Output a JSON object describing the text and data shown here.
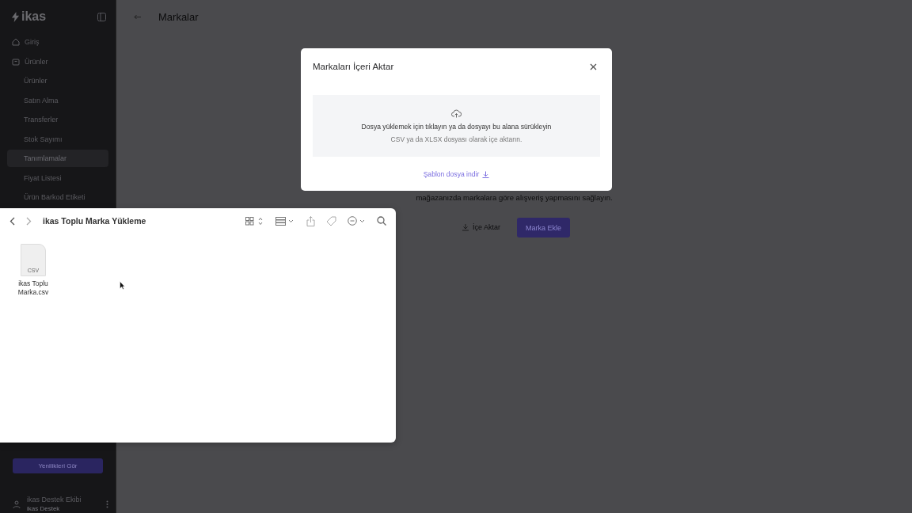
{
  "sidebar": {
    "logo": "ikas",
    "items": [
      {
        "label": "Giriş",
        "selected": false
      },
      {
        "label": "Ürünler",
        "selected": false,
        "children": [
          {
            "label": "Ürünler",
            "selected": false
          },
          {
            "label": "Satın Alma",
            "selected": false
          },
          {
            "label": "Transferler",
            "selected": false
          },
          {
            "label": "Stok Sayımı",
            "selected": false
          },
          {
            "label": "Tanımlamalar",
            "selected": true
          },
          {
            "label": "Fiyat Listesi",
            "selected": false
          },
          {
            "label": "Ürün Barkod Etiketi",
            "selected": false
          }
        ]
      }
    ],
    "news_button": "Yenilikleri Gör",
    "user": {
      "name": "ikas Destek Ekibi",
      "store": "ikas Destek"
    }
  },
  "page": {
    "title": "Markalar",
    "description": "mağazanızda markalara göre alışveriş yapmasını sağlayın.",
    "import_button": "İçe Aktar",
    "add_button": "Marka Ekle"
  },
  "modal": {
    "title": "Markaları İçeri Aktar",
    "drop_title": "Dosya yüklemek için tıklayın ya da dosyayı bu alana sürükleyin",
    "drop_hint": "CSV ya da XLSX dosyası olarak içe aktarın.",
    "template_link": "Şablon dosya indir"
  },
  "finder": {
    "title": "ikas Toplu Marka Yükleme",
    "files": [
      {
        "name": "ikas Toplu Marka.csv",
        "badge": "CSV"
      }
    ]
  }
}
